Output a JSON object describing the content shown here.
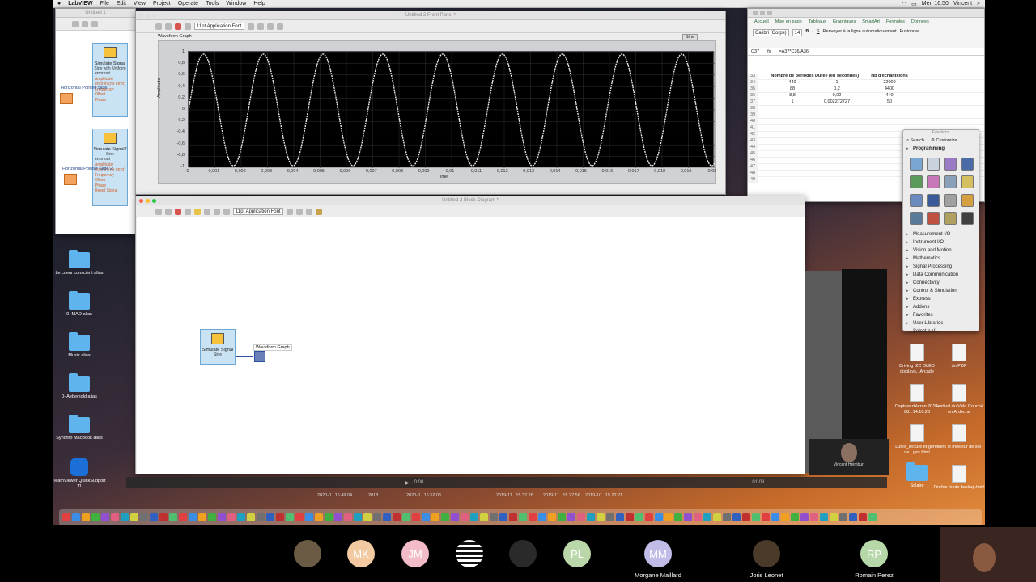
{
  "menubar": {
    "app": "LabVIEW",
    "items": [
      "File",
      "Edit",
      "View",
      "Project",
      "Operate",
      "Tools",
      "Window",
      "Help"
    ],
    "clock": "Mer. 16:50",
    "user": "Vincent"
  },
  "front_panel": {
    "title": "Untitled 2 Front Panel *",
    "font": "11pt Application Font",
    "graph_label": "Waveform Graph",
    "legend": "Sine",
    "y_axis_label": "Amplitude",
    "x_axis_label": "Time",
    "y_ticks": [
      "1",
      "0,8",
      "0,6",
      "0,4",
      "0,2",
      "0",
      "-0,2",
      "-0,4",
      "-0,6",
      "-0,8",
      "-1"
    ],
    "x_ticks": [
      "0",
      "0,001",
      "0,002",
      "0,003",
      "0,004",
      "0,005",
      "0,006",
      "0,007",
      "0,008",
      "0,009",
      "0,01",
      "0,011",
      "0,012",
      "0,013",
      "0,014",
      "0,015",
      "0,016",
      "0,017",
      "0,018",
      "0,019",
      "0,02"
    ]
  },
  "chart_data": {
    "type": "line",
    "title": "Waveform Graph",
    "xlabel": "Time",
    "ylabel": "Amplitude",
    "xlim": [
      0,
      0.02
    ],
    "ylim": [
      -1,
      1
    ],
    "series": [
      {
        "name": "Sine",
        "frequency_hz": 440,
        "amplitude": 1
      }
    ],
    "grid": true
  },
  "block_diagram": {
    "title": "Untitled 2 Block Diagram *",
    "font": "11pt Application Font",
    "node_label": "Simulate Signal",
    "node_output": "Sine",
    "graph_node_label": "Waveform Graph"
  },
  "left_window": {
    "title": "Untitled 1",
    "pointer1": "Horizontal Pointer Slide",
    "pointer2": "Horizontal Pointer Slide 2",
    "node1": "Simulate Signal",
    "node1_sub": "Sine with Uniform",
    "node1_ports": [
      "error out",
      "Amplitude",
      "error in (no error)",
      "Frequency",
      "Offset",
      "Phase"
    ],
    "node2": "Simulate Signal2",
    "node2_sub": "Sine",
    "node2_ports": [
      "error out",
      "Amplitude",
      "error in (no error)",
      "Frequency",
      "Offset",
      "Phase",
      "Reset Signal"
    ]
  },
  "excel": {
    "tabs": [
      "Accueil",
      "Mise en page",
      "Tableaux",
      "Graphiques",
      "SmartArt",
      "Formules",
      "Données"
    ],
    "font": "Calibri (Corps)",
    "font_size": "14",
    "cell_ref": "C37",
    "formula": "=A37*C36/A36",
    "wrap_label": "Renvoyer à la ligne automatiquement",
    "merge_label": "Fusionner",
    "headers": [
      "Nombre de périodes",
      "Durée (en secondes)",
      "Nb d'échantillons"
    ],
    "rows": [
      [
        "440",
        "1",
        "22000"
      ],
      [
        "88",
        "0,2",
        "4400"
      ],
      [
        "8,8",
        "0,02",
        "440"
      ],
      [
        "1",
        "0,002272727",
        "50"
      ]
    ],
    "row_numbers": [
      "33",
      "34",
      "35",
      "36",
      "37",
      "38",
      "39",
      "40",
      "41",
      "42",
      "43",
      "44",
      "45",
      "46",
      "47",
      "48",
      "49"
    ]
  },
  "palette": {
    "title": "Functions",
    "search": "Search",
    "customize": "Customize",
    "section": "Programming",
    "items": [
      "Measurement I/O",
      "Instrument I/O",
      "Vision and Motion",
      "Mathematics",
      "Signal Processing",
      "Data Communication",
      "Connectivity",
      "Control & Simulation",
      "Express",
      "Addons",
      "Favorites",
      "User Libraries",
      "Select a VI..."
    ]
  },
  "desktop_left": [
    {
      "label": "Le coeur conscient alias"
    },
    {
      "label": "0- MAO alias"
    },
    {
      "label": "Music alias"
    },
    {
      "label": "0- Aebersold alias"
    },
    {
      "label": "Synchro MacBook alias"
    },
    {
      "label": "TeamViewer QuickSupport 11"
    }
  ],
  "desktop_right": [
    {
      "label": "Driving I2C OLED displays...Arcade",
      "label2": "dmPDF"
    },
    {
      "label": "Capture d'écran 2019-08...14.10.23",
      "label2": "Festival du Vélo Couché en Ardèche"
    },
    {
      "label": "Lutex_lecture et gérer de...ges.html",
      "label2": "Vers le meilleur de soi"
    },
    {
      "label": "Solaire",
      "label2": "Firefox feeds backup.html"
    }
  ],
  "video_tile": {
    "name": "Vincent Heimburt"
  },
  "media": {
    "time": "0:00",
    "time2": "01:03"
  },
  "bottom_files": [
    "2020-0...15.49.04",
    "2018",
    "2020-0...15.52.06",
    "2019-11...15.32.28",
    "2019-11...15.27.56",
    "2019-10...15.22.21"
  ],
  "participants": [
    {
      "initials": "",
      "color": "#6b5a44",
      "name": ""
    },
    {
      "initials": "MK",
      "color": "#f2c9a0",
      "name": ""
    },
    {
      "initials": "JM",
      "color": "#f1bcc8",
      "name": ""
    },
    {
      "initials": "",
      "color": "#111111",
      "name": ""
    },
    {
      "initials": "",
      "color": "#2a2a2a",
      "name": ""
    },
    {
      "initials": "PL",
      "color": "#b9d7a8",
      "name": ""
    },
    {
      "initials": "MM",
      "color": "#c0bce8",
      "name": "Morgane Maillard"
    },
    {
      "initials": "",
      "color": "#4a3a2a",
      "name": "Joris Leonet"
    },
    {
      "initials": "RP",
      "color": "#b6d8a8",
      "name": "Romain Perez"
    }
  ]
}
